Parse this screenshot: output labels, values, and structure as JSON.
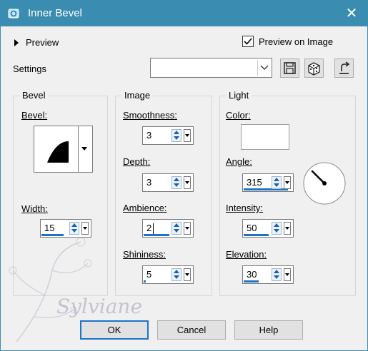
{
  "window": {
    "title": "Inner Bevel",
    "accent_color": "#3a8db0",
    "close_glyph": "✕"
  },
  "preview": {
    "toggle_label": "Preview",
    "preview_on_image_label": "Preview on Image",
    "preview_on_image_checked": true
  },
  "settings": {
    "label": "Settings",
    "preset_value": ""
  },
  "bevel_group": {
    "title": "Bevel",
    "bevel_label": "Bevel:",
    "width_label": "Width:",
    "width_value": "15"
  },
  "image_group": {
    "title": "Image",
    "smoothness_label": "Smoothness:",
    "smoothness_value": "3",
    "depth_label": "Depth:",
    "depth_value": "3",
    "ambience_label": "Ambience:",
    "ambience_value": "2",
    "shininess_label": "Shininess:",
    "shininess_value": "5"
  },
  "light_group": {
    "title": "Light",
    "color_label": "Color:",
    "color_value": "#ffffff",
    "angle_label": "Angle:",
    "angle_value": "315",
    "intensity_label": "Intensity:",
    "intensity_value": "50",
    "elevation_label": "Elevation:",
    "elevation_value": "30"
  },
  "buttons": {
    "ok": "OK",
    "cancel": "Cancel",
    "help": "Help"
  },
  "watermark": {
    "text": "Sylviane"
  }
}
